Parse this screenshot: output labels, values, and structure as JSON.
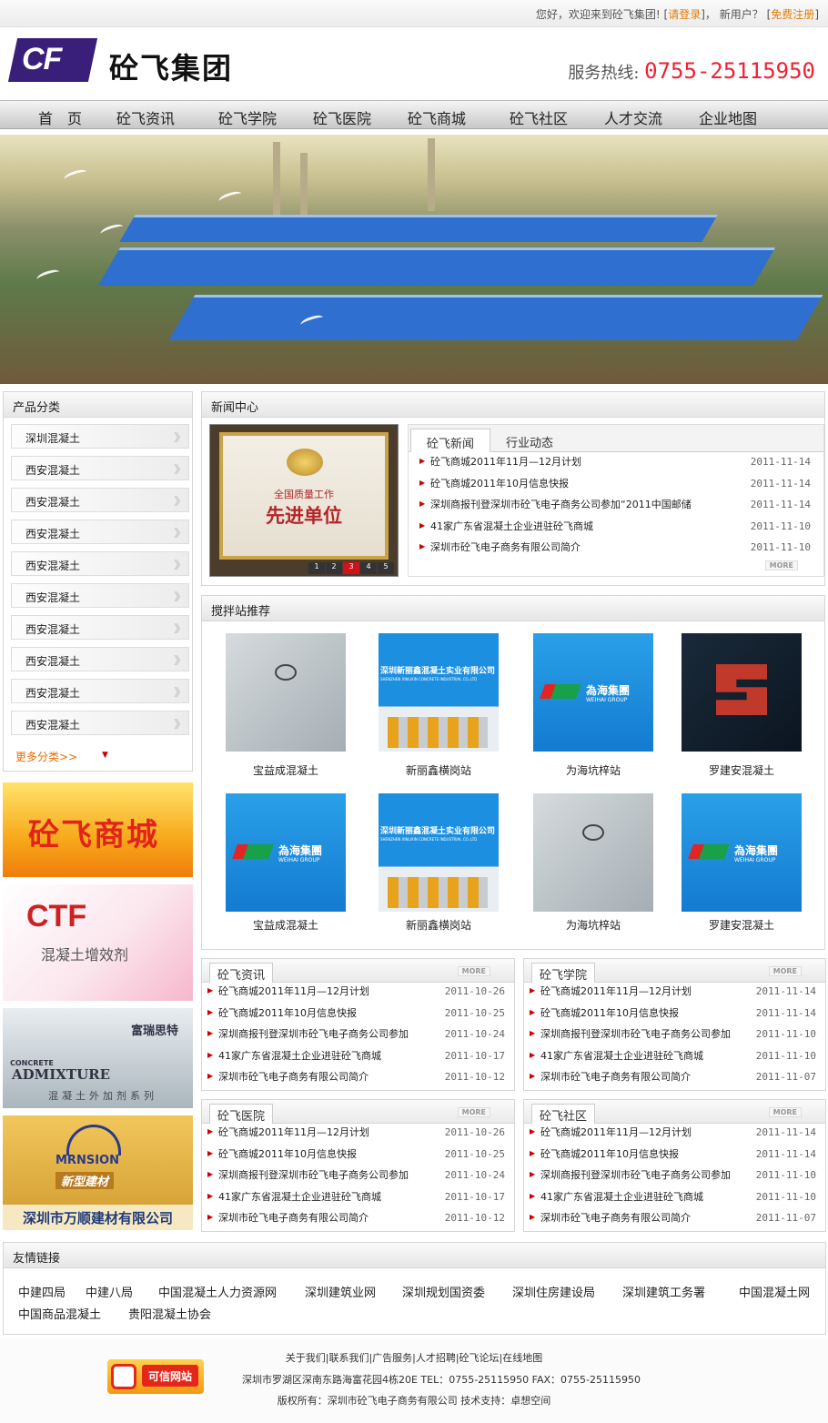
{
  "topbar": {
    "welcome": "您好，欢迎来到砼飞集团!",
    "login_label": "请登录",
    "new_user": "新用户？",
    "register_label": "免费注册"
  },
  "header": {
    "logo_mark": "CF",
    "company_name": "砼飞集团",
    "hotline_label": "服务热线:",
    "hotline_number": "0755-25115950"
  },
  "nav": [
    "首　页",
    "砼飞资讯",
    "砼飞学院",
    "砼飞医院",
    "砼飞商城",
    "砼飞社区",
    "人才交流",
    "企业地图"
  ],
  "categories": {
    "title": "产品分类",
    "items": [
      "深圳混凝土",
      "西安混凝土",
      "西安混凝土",
      "西安混凝土",
      "西安混凝土",
      "西安混凝土",
      "西安混凝土",
      "西安混凝土",
      "西安混凝土",
      "西安混凝土"
    ],
    "more_label": "更多分类>>"
  },
  "ads": {
    "mall_text": "砼飞商城",
    "ctf_logo": "CTF",
    "ctf_text": "混凝土增效剂",
    "admix_brand": "富瑞思特",
    "admix_concrete": "CONCRETE",
    "admix_title": "ADMIXTURE",
    "admix_sub": "混凝土外加剂系列",
    "wanshun_logo": "MRNSION",
    "wanshun_banner": "新型建材",
    "wanshun_name": "深圳市万顺建材有限公司"
  },
  "news_center": {
    "title": "新闻中心",
    "image_line1": "全国质量工作",
    "image_line2": "先进单位",
    "pager": [
      "1",
      "2",
      "3",
      "4",
      "5"
    ],
    "tabs": [
      "砼飞新闻",
      "行业动态"
    ],
    "items": [
      {
        "title": "砼飞商城2011年11月—12月计划",
        "date": "2011-11-14"
      },
      {
        "title": "砼飞商城2011年10月信息快报",
        "date": "2011-11-14"
      },
      {
        "title": "深圳商报刊登深圳市砼飞电子商务公司参加“2011中国邮储",
        "date": "2011-11-14"
      },
      {
        "title": "41家广东省混凝土企业进驻砼飞商城",
        "date": "2011-11-10"
      },
      {
        "title": "深圳市砼飞电子商务有限公司简介",
        "date": "2011-11-10"
      }
    ],
    "more_label": "MORE"
  },
  "stations": {
    "title": "搅拌站推荐",
    "items": [
      {
        "name": "宝益成混凝土",
        "type": "gray"
      },
      {
        "name": "新丽鑫横岗站",
        "type": "xinlixin"
      },
      {
        "name": "为海坑梓站",
        "type": "weihai"
      },
      {
        "name": "罗建安混凝土",
        "type": "dark"
      },
      {
        "name": "宝益成混凝土",
        "type": "weihai"
      },
      {
        "name": "新丽鑫横岗站",
        "type": "xinlixin"
      },
      {
        "name": "为海坑梓站",
        "type": "gray"
      },
      {
        "name": "罗建安混凝土",
        "type": "weihai"
      }
    ],
    "xinlixin_cn": "深圳新丽鑫混凝土实业有限公司",
    "xinlixin_en": "SHENZHEN XINLIXIN CONCRETE INDUSTRIAL CO.,LTD",
    "weihai_cn": "為海集團",
    "weihai_en": "WEIHAI GROUP"
  },
  "columns": [
    {
      "title": "砼飞资讯",
      "items": [
        {
          "title": "砼飞商城2011年11月—12月计划",
          "date": "2011-10-26"
        },
        {
          "title": "砼飞商城2011年10月信息快报",
          "date": "2011-10-25"
        },
        {
          "title": "深圳商报刊登深圳市砼飞电子商务公司参加",
          "date": "2011-10-24"
        },
        {
          "title": "41家广东省混凝土企业进驻砼飞商城",
          "date": "2011-10-17"
        },
        {
          "title": "深圳市砼飞电子商务有限公司简介",
          "date": "2011-10-12"
        }
      ]
    },
    {
      "title": "砼飞学院",
      "items": [
        {
          "title": "砼飞商城2011年11月—12月计划",
          "date": "2011-11-14"
        },
        {
          "title": "砼飞商城2011年10月信息快报",
          "date": "2011-11-14"
        },
        {
          "title": "深圳商报刊登深圳市砼飞电子商务公司参加",
          "date": "2011-11-10"
        },
        {
          "title": "41家广东省混凝土企业进驻砼飞商城",
          "date": "2011-11-10"
        },
        {
          "title": "深圳市砼飞电子商务有限公司简介",
          "date": "2011-11-07"
        }
      ]
    },
    {
      "title": "砼飞医院",
      "items": [
        {
          "title": "砼飞商城2011年11月—12月计划",
          "date": "2011-10-26"
        },
        {
          "title": "砼飞商城2011年10月信息快报",
          "date": "2011-10-25"
        },
        {
          "title": "深圳商报刊登深圳市砼飞电子商务公司参加",
          "date": "2011-10-24"
        },
        {
          "title": "41家广东省混凝土企业进驻砼飞商城",
          "date": "2011-10-17"
        },
        {
          "title": "深圳市砼飞电子商务有限公司简介",
          "date": "2011-10-12"
        }
      ]
    },
    {
      "title": "砼飞社区",
      "items": [
        {
          "title": "砼飞商城2011年11月—12月计划",
          "date": "2011-11-14"
        },
        {
          "title": "砼飞商城2011年10月信息快报",
          "date": "2011-11-14"
        },
        {
          "title": "深圳商报刊登深圳市砼飞电子商务公司参加",
          "date": "2011-11-10"
        },
        {
          "title": "41家广东省混凝土企业进驻砼飞商城",
          "date": "2011-11-10"
        },
        {
          "title": "深圳市砼飞电子商务有限公司简介",
          "date": "2011-11-07"
        }
      ]
    }
  ],
  "friend_links": {
    "title": "友情链接",
    "links": [
      "中建四局",
      "中建八局",
      "中国混凝土人力资源网",
      "深圳建筑业网",
      "深圳规划国资委",
      "深圳住房建设局",
      "深圳建筑工务署",
      "中国混凝土网",
      "中国商品混凝土",
      "贵阳混凝土协会"
    ]
  },
  "footer": {
    "links": "关于我们|联系我们|广告服务|人才招聘|砼飞论坛|在线地图",
    "address": "深圳市罗湖区深南东路海富花园4栋20E TEL：0755-25115950 FAX：0755-25115950",
    "copyright": "版权所有：深圳市砼飞电子商务有限公司 技术支持：卓想空间",
    "trust_badge": "可信网站"
  }
}
